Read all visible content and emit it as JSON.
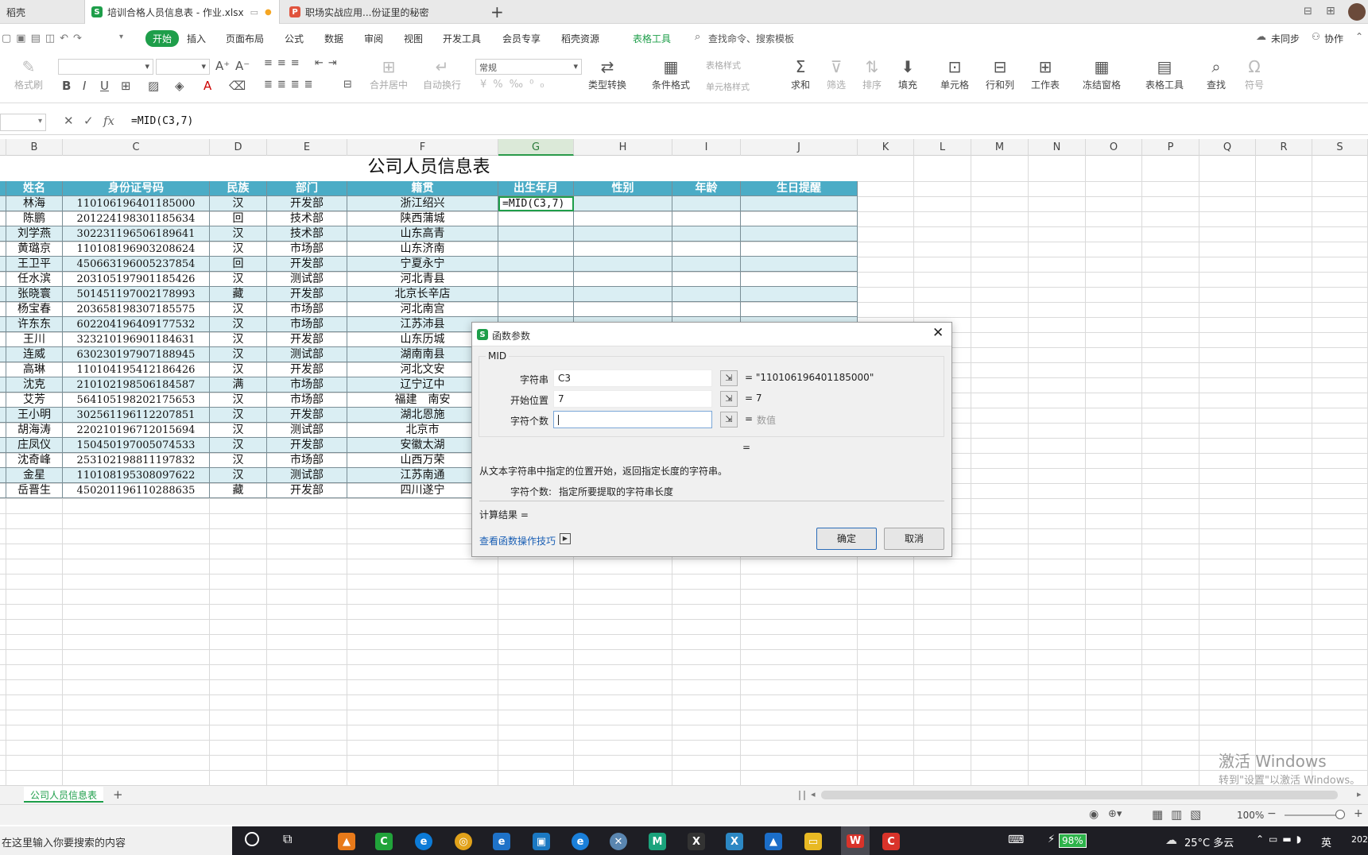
{
  "tabs": {
    "first": "稻壳",
    "second": "培训合格人员信息表 - 作业.xlsx",
    "third": "职场实战应用...份证里的秘密",
    "new_tab": "+"
  },
  "menu": {
    "start": "开始",
    "insert": "插入",
    "layout": "页面布局",
    "formula": "公式",
    "data": "数据",
    "review": "审阅",
    "view": "视图",
    "dev": "开发工具",
    "member": "会员专享",
    "docer": "稻壳资源",
    "table_tools": "表格工具",
    "search": "查找命令、搜索模板",
    "unsync": "未同步",
    "collab": "协作"
  },
  "toolbar": {
    "format_painter": "格式刷",
    "merge_center": "合并居中",
    "wrap": "自动换行",
    "number_format": "常规",
    "type_convert": "类型转换",
    "cond_format": "条件格式",
    "table_style": "表格样式",
    "cell_style": "单元格样式",
    "sum": "求和",
    "filter": "筛选",
    "sort": "排序",
    "fill": "填充",
    "cell": "单元格",
    "rowcol": "行和列",
    "worksheet": "工作表",
    "freeze": "冻结窗格",
    "table_tool": "表格工具",
    "find": "查找",
    "symbol": "符号"
  },
  "formula_bar": {
    "fx": "fx",
    "formula": "=MID(C3,7)"
  },
  "columns": [
    "B",
    "C",
    "D",
    "E",
    "F",
    "G",
    "H",
    "I",
    "J",
    "K",
    "L",
    "M",
    "N",
    "O",
    "P",
    "Q",
    "R",
    "S"
  ],
  "sheet": {
    "title": "公司人员信息表",
    "headers": [
      "姓名",
      "身份证号码",
      "民族",
      "部门",
      "籍贯",
      "出生年月",
      "性别",
      "年龄",
      "生日提醒"
    ],
    "editing_cell": "=MID(C3,7)",
    "rows": [
      [
        "林海",
        "110106196401185000",
        "汉",
        "开发部",
        "浙江绍兴"
      ],
      [
        "陈鹏",
        "201224198301185634",
        "回",
        "技术部",
        "陕西蒲城"
      ],
      [
        "刘学燕",
        "302231196506189641",
        "汉",
        "技术部",
        "山东高青"
      ],
      [
        "黄璐京",
        "110108196903208624",
        "汉",
        "市场部",
        "山东济南"
      ],
      [
        "王卫平",
        "450663196005237854",
        "回",
        "开发部",
        "宁夏永宁"
      ],
      [
        "任水滨",
        "203105197901185426",
        "汉",
        "测试部",
        "河北青县"
      ],
      [
        "张晓寰",
        "501451197002178993",
        "藏",
        "开发部",
        "北京长辛店"
      ],
      [
        "杨宝春",
        "203658198307185575",
        "汉",
        "市场部",
        "河北南宫"
      ],
      [
        "许东东",
        "602204196409177532",
        "汉",
        "市场部",
        "江苏沛县"
      ],
      [
        "王川",
        "323210196901184631",
        "汉",
        "开发部",
        "山东历城"
      ],
      [
        "连威",
        "630230197907188945",
        "汉",
        "测试部",
        "湖南南县"
      ],
      [
        "高琳",
        "110104195412186426",
        "汉",
        "开发部",
        "河北文安"
      ],
      [
        "沈克",
        "210102198506184587",
        "满",
        "市场部",
        "辽宁辽中"
      ],
      [
        "艾芳",
        "564105198202175653",
        "汉",
        "市场部",
        "福建　南安"
      ],
      [
        "王小明",
        "302561196112207851",
        "汉",
        "开发部",
        "湖北恩施"
      ],
      [
        "胡海涛",
        "220210196712015694",
        "汉",
        "测试部",
        "北京市"
      ],
      [
        "庄凤仪",
        "150450197005074533",
        "汉",
        "开发部",
        "安徽太湖"
      ],
      [
        "沈奇峰",
        "253102198811197832",
        "汉",
        "市场部",
        "山西万荣"
      ],
      [
        "金星",
        "110108195308097622",
        "汉",
        "测试部",
        "江苏南通"
      ],
      [
        "岳晋生",
        "450201196110288635",
        "藏",
        "开发部",
        "四川遂宁"
      ]
    ]
  },
  "dialog": {
    "title": "函数参数",
    "func": "MID",
    "arg1_label": "字符串",
    "arg1_value": "C3",
    "arg1_result": "= \"110106196401185000\"",
    "arg2_label": "开始位置",
    "arg2_value": "7",
    "arg2_result": "= 7",
    "arg3_label": "字符个数",
    "arg3_value": "",
    "arg3_eq": "=",
    "arg3_result": "数值",
    "total_eq": "=",
    "description": "从文本字符串中指定的位置开始，返回指定长度的字符串。",
    "param_help_label": "字符个数:",
    "param_help": "指定所要提取的字符串长度",
    "calc_result": "计算结果 =",
    "help_link": "查看函数操作技巧",
    "ok": "确定",
    "cancel": "取消"
  },
  "sheet_tab": "公司人员信息表",
  "status": {
    "zoom": "100%"
  },
  "watermark": {
    "line1": "激活 Windows",
    "line2": "转到\"设置\"以激活 Windows。"
  },
  "taskbar": {
    "search": "在这里输入你要搜索的内容",
    "battery": "98%",
    "weather": "25°C 多云",
    "ime": "英",
    "year": "202"
  },
  "colors": {
    "header_bg": "#4bacc6",
    "stripe_bg": "#daeef3",
    "accent_green": "#1e9e4a"
  }
}
